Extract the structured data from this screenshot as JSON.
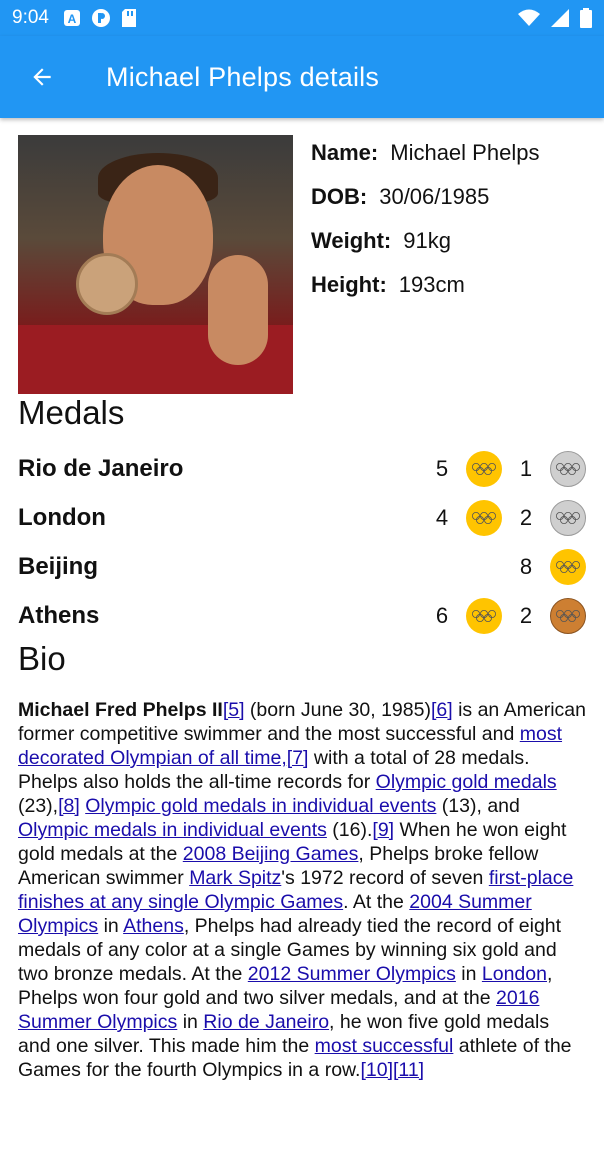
{
  "status_bar": {
    "time": "9:04"
  },
  "app_bar": {
    "title": "Michael Phelps details"
  },
  "profile": {
    "fields": [
      {
        "label": "Name:",
        "value": "Michael Phelps"
      },
      {
        "label": "DOB:",
        "value": "30/06/1985"
      },
      {
        "label": "Weight:",
        "value": "91kg"
      },
      {
        "label": "Height:",
        "value": "193cm"
      }
    ]
  },
  "medals": {
    "title": "Medals",
    "games": [
      {
        "venue": "Rio de Janeiro",
        "gold": "5",
        "silver": "1"
      },
      {
        "venue": "London",
        "gold": "4",
        "silver": "2"
      },
      {
        "venue": "Beijing",
        "gold": "8"
      },
      {
        "venue": "Athens",
        "gold": "6",
        "bronze": "2"
      }
    ],
    "colors": {
      "gold": "#FFC400",
      "silver": "#cfcfcf",
      "bronze": "#CD7F32"
    }
  },
  "bio": {
    "title": "Bio",
    "segments": [
      {
        "t": "Michael Fred Phelps II",
        "b": true
      },
      {
        "t": "[5]",
        "link": true
      },
      {
        "t": " (born June 30, 1985)"
      },
      {
        "t": "[6]",
        "link": true
      },
      {
        "t": " is an American former competitive swimmer and the most successful and "
      },
      {
        "t": "most decorated Olympian of all time,",
        "link": true
      },
      {
        "t": "[7]",
        "link": true
      },
      {
        "t": " with a total of 28 medals. Phelps also holds the all-time records for "
      },
      {
        "t": "Olympic gold medals",
        "link": true
      },
      {
        "t": " (23),"
      },
      {
        "t": "[8]",
        "link": true
      },
      {
        "t": " "
      },
      {
        "t": "Olympic gold medals in individual events",
        "link": true
      },
      {
        "t": " (13), and "
      },
      {
        "t": "Olympic medals in individual events",
        "link": true
      },
      {
        "t": " (16)."
      },
      {
        "t": "[9]",
        "link": true
      },
      {
        "t": " When he won eight gold medals at the "
      },
      {
        "t": "2008 Beijing Games",
        "link": true
      },
      {
        "t": ", Phelps broke fellow American swimmer "
      },
      {
        "t": "Mark Spitz",
        "link": true
      },
      {
        "t": "'s 1972 record of seven "
      },
      {
        "t": "first-place finishes at any single Olympic Games",
        "link": true
      },
      {
        "t": ". At the "
      },
      {
        "t": "2004 Summer Olympics",
        "link": true
      },
      {
        "t": " in "
      },
      {
        "t": "Athens",
        "link": true
      },
      {
        "t": ", Phelps had already tied the record of eight medals of any color at a single Games by winning six gold and two bronze medals. At the "
      },
      {
        "t": "2012 Summer Olympics",
        "link": true
      },
      {
        "t": " in "
      },
      {
        "t": "London",
        "link": true
      },
      {
        "t": ", Phelps won four gold and two silver medals, and at the "
      },
      {
        "t": "2016 Summer Olympics",
        "link": true
      },
      {
        "t": " in "
      },
      {
        "t": "Rio de Janeiro",
        "link": true
      },
      {
        "t": ", he won five gold medals and one silver. This made him the "
      },
      {
        "t": "most successful",
        "link": true
      },
      {
        "t": " athlete of the Games for the fourth Olympics in a row."
      },
      {
        "t": "[10]",
        "link": true
      },
      {
        "t": "[11]",
        "link": true
      }
    ]
  }
}
